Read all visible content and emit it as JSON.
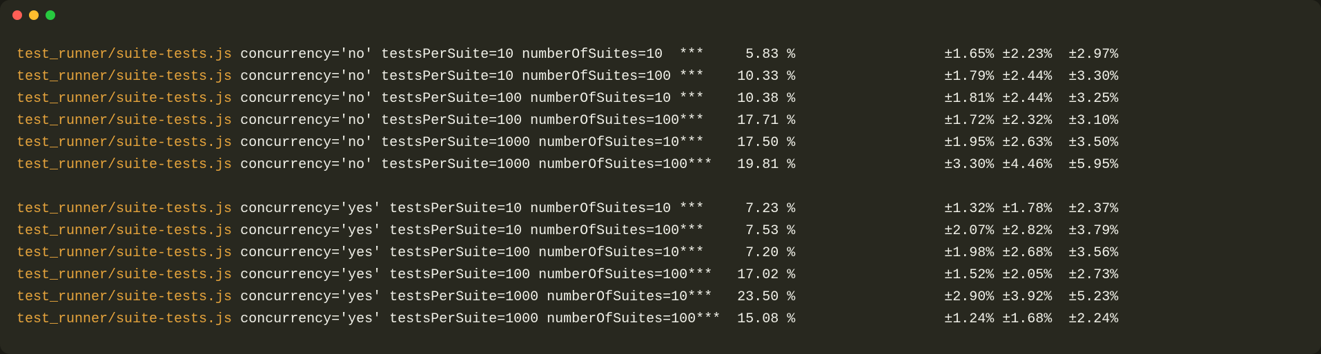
{
  "window": {
    "buttons": {
      "close": "close",
      "minimize": "minimize",
      "zoom": "zoom"
    }
  },
  "terminal": {
    "path": "test_runner/suite-tests.js",
    "rows": [
      {
        "blank": false,
        "concurrency": "'no'",
        "testsPerSuite": "10",
        "numberOfSuites": "10",
        "stars": "***",
        "pct": "5.83",
        "ci1": "±1.65%",
        "ci2": "±2.23%",
        "ci3": "±2.97%"
      },
      {
        "blank": false,
        "concurrency": "'no'",
        "testsPerSuite": "10",
        "numberOfSuites": "100",
        "stars": "***",
        "pct": "10.33",
        "ci1": "±1.79%",
        "ci2": "±2.44%",
        "ci3": "±3.30%"
      },
      {
        "blank": false,
        "concurrency": "'no'",
        "testsPerSuite": "100",
        "numberOfSuites": "10",
        "stars": "***",
        "pct": "10.38",
        "ci1": "±1.81%",
        "ci2": "±2.44%",
        "ci3": "±3.25%"
      },
      {
        "blank": false,
        "concurrency": "'no'",
        "testsPerSuite": "100",
        "numberOfSuites": "100",
        "stars": "***",
        "pct": "17.71",
        "ci1": "±1.72%",
        "ci2": "±2.32%",
        "ci3": "±3.10%"
      },
      {
        "blank": false,
        "concurrency": "'no'",
        "testsPerSuite": "1000",
        "numberOfSuites": "10",
        "stars": "***",
        "pct": "17.50",
        "ci1": "±1.95%",
        "ci2": "±2.63%",
        "ci3": "±3.50%"
      },
      {
        "blank": false,
        "concurrency": "'no'",
        "testsPerSuite": "1000",
        "numberOfSuites": "100",
        "stars": "***",
        "pct": "19.81",
        "ci1": "±3.30%",
        "ci2": "±4.46%",
        "ci3": "±5.95%"
      },
      {
        "blank": true
      },
      {
        "blank": false,
        "concurrency": "'yes'",
        "testsPerSuite": "10",
        "numberOfSuites": "10",
        "stars": "***",
        "pct": "7.23",
        "ci1": "±1.32%",
        "ci2": "±1.78%",
        "ci3": "±2.37%"
      },
      {
        "blank": false,
        "concurrency": "'yes'",
        "testsPerSuite": "10",
        "numberOfSuites": "100",
        "stars": "***",
        "pct": "7.53",
        "ci1": "±2.07%",
        "ci2": "±2.82%",
        "ci3": "±3.79%"
      },
      {
        "blank": false,
        "concurrency": "'yes'",
        "testsPerSuite": "100",
        "numberOfSuites": "10",
        "stars": "***",
        "pct": "7.20",
        "ci1": "±1.98%",
        "ci2": "±2.68%",
        "ci3": "±3.56%"
      },
      {
        "blank": false,
        "concurrency": "'yes'",
        "testsPerSuite": "100",
        "numberOfSuites": "100",
        "stars": "***",
        "pct": "17.02",
        "ci1": "±1.52%",
        "ci2": "±2.05%",
        "ci3": "±2.73%"
      },
      {
        "blank": false,
        "concurrency": "'yes'",
        "testsPerSuite": "1000",
        "numberOfSuites": "10",
        "stars": "***",
        "pct": "23.50",
        "ci1": "±2.90%",
        "ci2": "±3.92%",
        "ci3": "±5.23%"
      },
      {
        "blank": false,
        "concurrency": "'yes'",
        "testsPerSuite": "1000",
        "numberOfSuites": "100",
        "stars": "***",
        "pct": "15.08",
        "ci1": "±1.24%",
        "ci2": "±1.68%",
        "ci3": "±2.24%"
      }
    ],
    "columns": {
      "params_width": 72,
      "stars_col": 80,
      "pct_col": 92,
      "pct_unit": " %",
      "ci1_col": 112,
      "ci2_col": 119,
      "ci3_col": 127
    },
    "labels": {
      "concurrency": "concurrency=",
      "testsPerSuite": "testsPerSuite=",
      "numberOfSuites": "numberOfSuites="
    }
  }
}
